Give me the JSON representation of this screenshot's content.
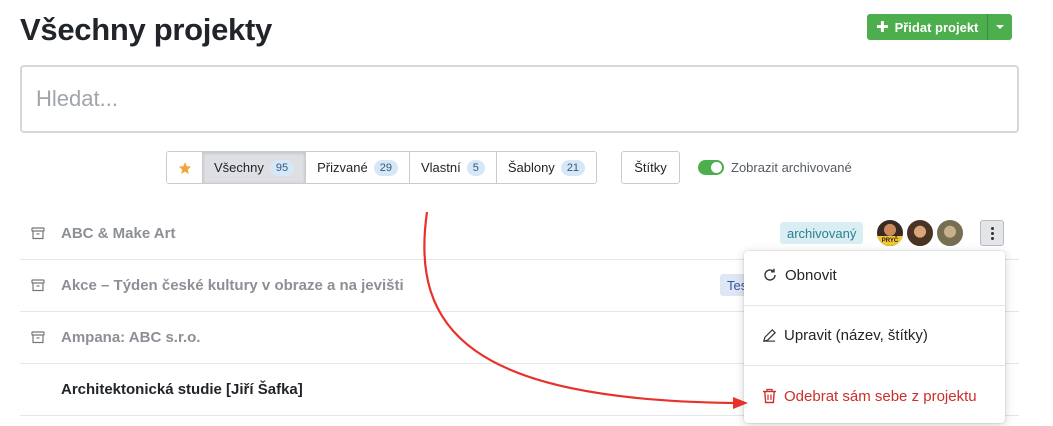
{
  "page": {
    "title": "Všechny projekty"
  },
  "header": {
    "add_label": "Přidat projekt"
  },
  "search": {
    "placeholder": "Hledat..."
  },
  "filters": [
    {
      "label": "Všechny",
      "count": "95",
      "active": true
    },
    {
      "label": "Přizvané",
      "count": "29",
      "active": false
    },
    {
      "label": "Vlastní",
      "count": "5",
      "active": false
    },
    {
      "label": "Šablony",
      "count": "21",
      "active": false
    }
  ],
  "tags_label": "Štítky",
  "show_archived": {
    "label": "Zobrazit archivované",
    "enabled": true
  },
  "projects": [
    {
      "name": "ABC & Make Art",
      "archived": true,
      "badge": "archivovaný"
    },
    {
      "name": "Akce – Týden české kultury v obraze a na jevišti",
      "archived": true,
      "badge": "Tes"
    },
    {
      "name": "Ampana: ABC s.r.o.",
      "archived": true
    },
    {
      "name": "Architektonická studie [Jiří Šafka]",
      "archived": false
    }
  ],
  "avatars": [
    {
      "label": "PRYČ"
    }
  ],
  "context_menu": {
    "restore": "Obnovit",
    "edit": "Upravit (název, štítky)",
    "leave": "Odebrat sám sebe z projektu"
  },
  "colors": {
    "accent_green": "#4cae4c",
    "danger_red": "#c9302c",
    "annotation_arrow": "#e8312a"
  }
}
